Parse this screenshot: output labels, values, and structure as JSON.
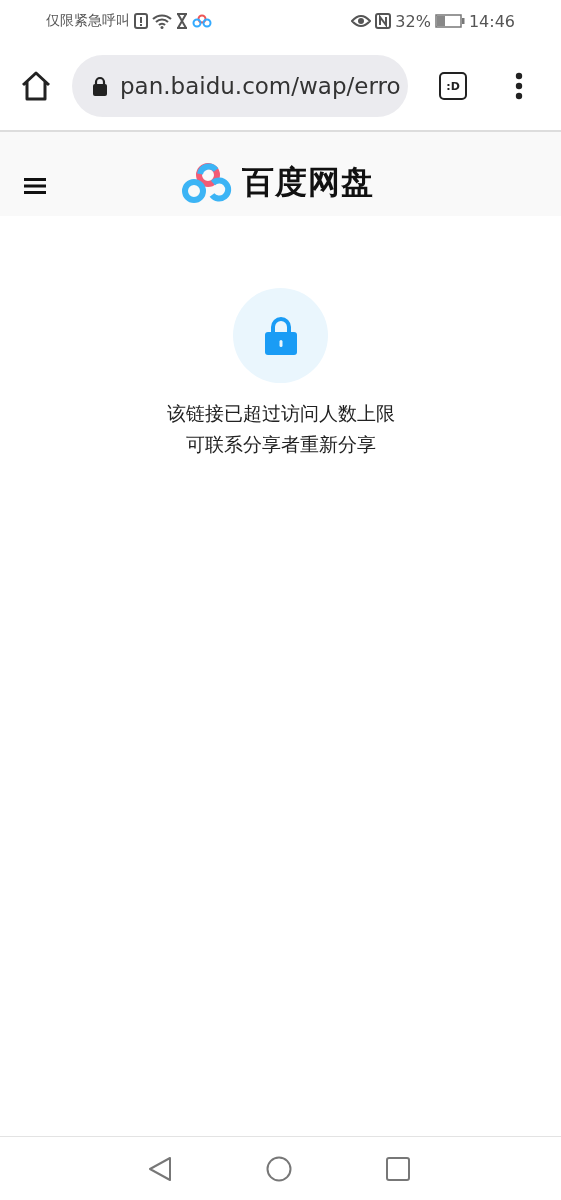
{
  "status_bar": {
    "carrier": "仅限紧急呼叫",
    "battery": "32%",
    "time": "14:46"
  },
  "browser": {
    "url": "pan.baidu.com/wap/erro",
    "tab_switcher": ":D"
  },
  "header": {
    "logo_text": "百度网盘"
  },
  "message": {
    "lines": [
      "该链接已超过访问人数上限",
      "可联系分享者重新分享"
    ]
  }
}
